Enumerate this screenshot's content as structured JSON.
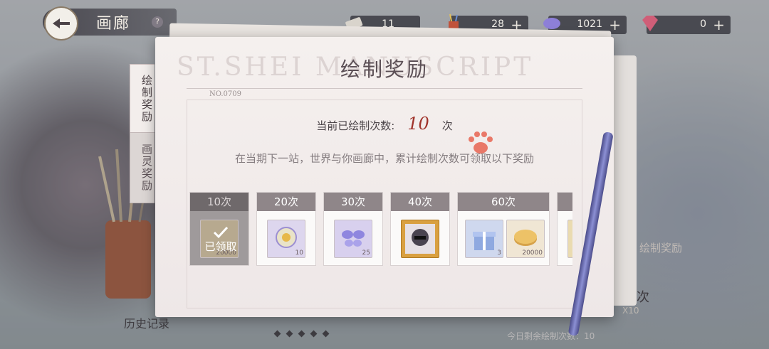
{
  "header": {
    "title": "画廊",
    "help_symbol": "?",
    "resources": [
      {
        "name": "ticket",
        "icon": "ticket-icon",
        "value": "11",
        "has_plus": false
      },
      {
        "name": "pen-jar",
        "icon": "pen-jar-icon",
        "value": "28",
        "has_plus": true
      },
      {
        "name": "crystal",
        "icon": "crystal-icon",
        "value": "1021",
        "has_plus": true
      },
      {
        "name": "gem",
        "icon": "gem-icon",
        "value": "0",
        "has_plus": true
      }
    ],
    "plus_symbol": "+"
  },
  "side_tabs": [
    {
      "label": "绘制奖励",
      "active": true
    },
    {
      "label": "画灵奖励",
      "active": false
    }
  ],
  "modal": {
    "watermark": "ST.SHEI MANUSCRIPT",
    "title": "绘制奖励",
    "serial": "NO.0709",
    "count_label": "当前已绘制次数:",
    "count_value": "10",
    "count_unit": "次",
    "description": "在当期下一站，世界与你画廊中，累计绘制次数可领取以下奖励",
    "claimed_label": "已领取",
    "rewards": [
      {
        "tier": "10次",
        "claimed": true,
        "items": [
          {
            "icon": "coin-icon",
            "qty": "20000"
          }
        ]
      },
      {
        "tier": "20次",
        "claimed": false,
        "items": [
          {
            "icon": "sun-medallion-icon",
            "qty": "10"
          }
        ]
      },
      {
        "tier": "30次",
        "claimed": false,
        "items": [
          {
            "icon": "butterfly-icon",
            "qty": "25"
          }
        ]
      },
      {
        "tier": "40次",
        "claimed": false,
        "items": [
          {
            "icon": "avatar-frame-icon",
            "qty": ""
          }
        ]
      },
      {
        "tier": "60次",
        "claimed": false,
        "items": [
          {
            "icon": "gift-box-icon",
            "qty": "3"
          },
          {
            "icon": "coin-icon",
            "qty": "20000"
          }
        ]
      },
      {
        "tier": "",
        "claimed": false,
        "items": [
          {
            "icon": "scroll-icon",
            "qty": ""
          }
        ]
      }
    ]
  },
  "background": {
    "bottom_left_label": "历史记录",
    "bottom_right_label": "今日剩余绘制次数：10",
    "draw_label": "绘制奖励",
    "times_label": "次",
    "multiplier_label": "X10"
  }
}
